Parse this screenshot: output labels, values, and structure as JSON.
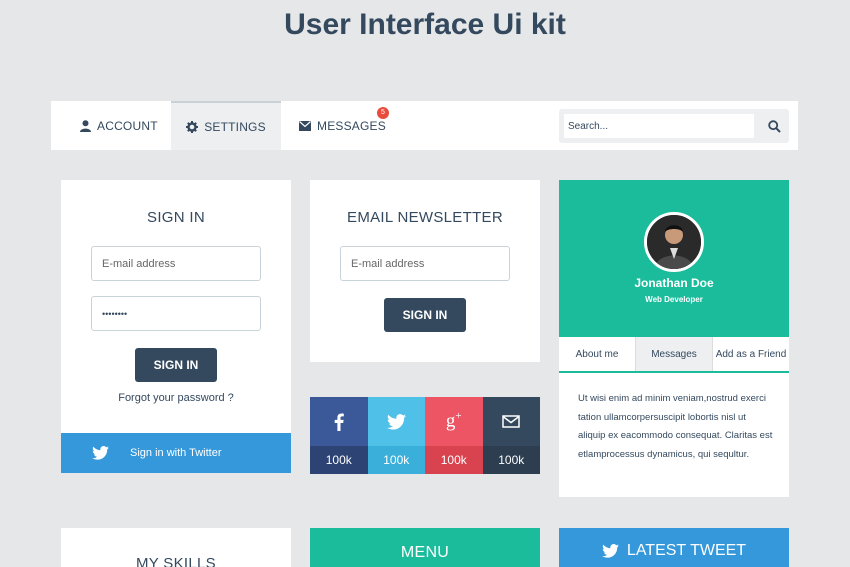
{
  "page": {
    "title": "User Interface Ui kit"
  },
  "nav": {
    "tabs": [
      {
        "label": "ACCOUNT"
      },
      {
        "label": "SETTINGS"
      },
      {
        "label": "MESSAGES"
      }
    ],
    "messages_badge": "5",
    "search": {
      "placeholder": "Search..."
    }
  },
  "signin": {
    "title": "SIGN IN",
    "email_placeholder": "E-mail address",
    "password_value": "••••••••",
    "button": "SIGN IN",
    "forgot": "Forgot your password ?",
    "twitter": "Sign in with Twitter"
  },
  "newsletter": {
    "title": "EMAIL NEWSLETTER",
    "email_placeholder": "E-mail address",
    "button": "SIGN IN"
  },
  "social": [
    {
      "name": "facebook-icon",
      "count": "100k",
      "color": "#3b5998",
      "count_color": "#2d4373"
    },
    {
      "name": "twitter-icon",
      "count": "100k",
      "color": "#4fc1e9",
      "count_color": "#3aafda"
    },
    {
      "name": "google-plus-icon",
      "count": "100k",
      "color": "#ed5565",
      "count_color": "#d9434f"
    },
    {
      "name": "mail-icon",
      "count": "100k",
      "color": "#34495e",
      "count_color": "#2c3e50"
    }
  ],
  "profile": {
    "name": "Jonathan Doe",
    "role": "Web Developer",
    "tabs": [
      "About me",
      "Messages",
      "Add as a Friend"
    ],
    "bio": "Ut wisi enim ad minim veniam,nostrud exerci tation ullamcorpersuscipit lobortis nisl ut aliquip ex eacommodo consequat. Claritas est etlamprocessus dynamicus, qui sequltur."
  },
  "bottom": {
    "skills_title": "MY SKILLS",
    "menu_title": "MENU",
    "tweet_title": "LATEST TWEET"
  },
  "colors": {
    "dark": "#34495e",
    "teal": "#1abc9c",
    "blue": "#3498db",
    "badge": "#e74c3c"
  }
}
